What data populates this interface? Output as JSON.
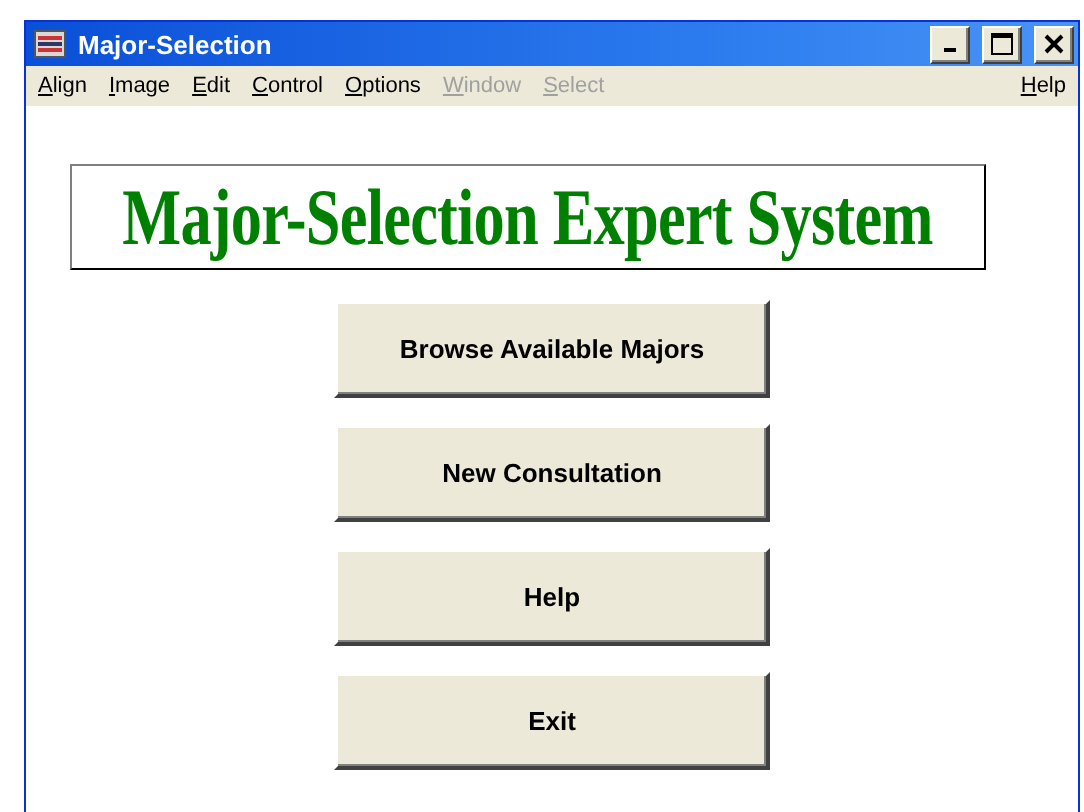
{
  "window": {
    "title": "Major-Selection"
  },
  "menu": [
    {
      "label": "Align",
      "disabled": false
    },
    {
      "label": "Image",
      "disabled": false
    },
    {
      "label": "Edit",
      "disabled": false
    },
    {
      "label": "Control",
      "disabled": false
    },
    {
      "label": "Options",
      "disabled": false
    },
    {
      "label": "Window",
      "disabled": true
    },
    {
      "label": "Select",
      "disabled": true
    }
  ],
  "menu_right": {
    "label": "Help",
    "disabled": false
  },
  "banner": "Major-Selection Expert System",
  "buttons": [
    "Browse Available Majors",
    "New Consultation",
    "Help",
    "Exit"
  ]
}
